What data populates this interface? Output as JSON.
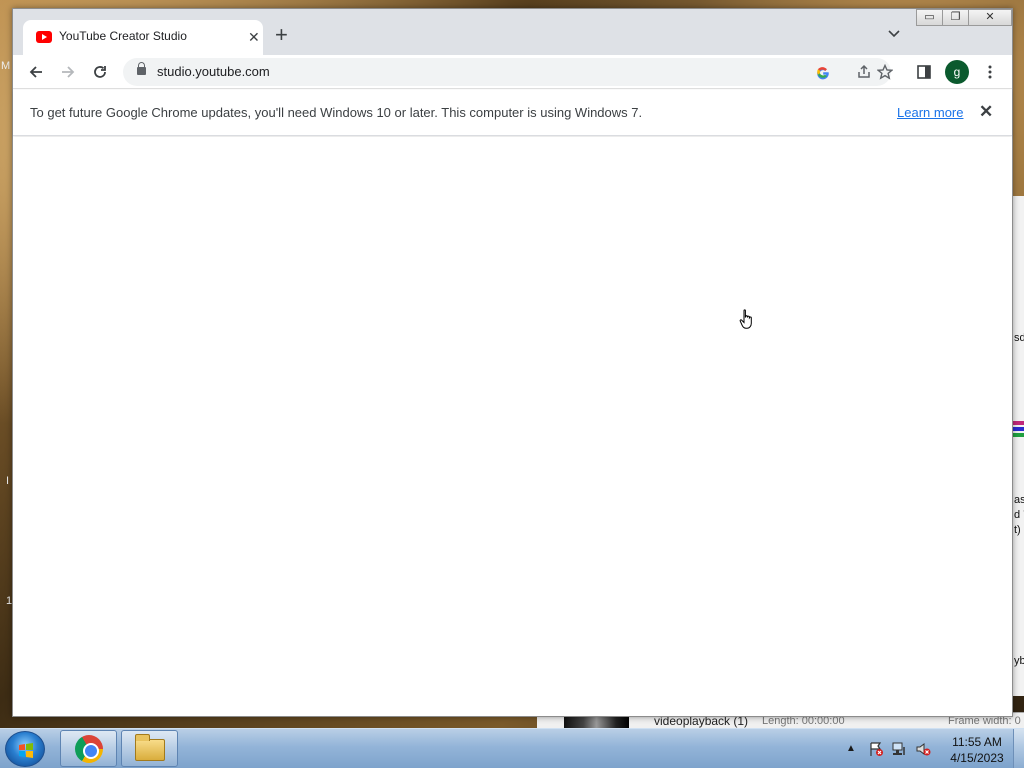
{
  "browser": {
    "tab": {
      "title": "YouTube Creator Studio",
      "favicon": "youtube-icon",
      "close_glyph": "✕"
    },
    "new_tab_glyph": "+",
    "window_controls": {
      "minimize": "▭",
      "restore": "❐",
      "close": "✕"
    },
    "toolbar": {
      "url": "studio.youtube.com",
      "profile_initial": "g"
    },
    "infobar": {
      "message": "To get future Google Chrome updates, you'll need Windows 10 or later. This computer is using Windows 7.",
      "link": "Learn more",
      "close_glyph": "✕"
    }
  },
  "background_window": {
    "text_1": "sd",
    "text_2": "as",
    "text_3": "d 7",
    "text_4": "t)",
    "text_5": "yb",
    "media_title": "videoplayback (1)",
    "media_length": "Length: 00:00:00",
    "media_frame": "Frame width: 0"
  },
  "desktop": {
    "left_edge_1": "M",
    "left_edge_2": "I",
    "left_edge_3": "1"
  },
  "taskbar": {
    "clock_time": "11:55 AM",
    "clock_date": "4/15/2023"
  },
  "colors": {
    "chrome_tabstrip": "#dee1e6",
    "link": "#1a73e8",
    "avatar": "#0b5a2e",
    "youtube_red": "#ff0000"
  }
}
